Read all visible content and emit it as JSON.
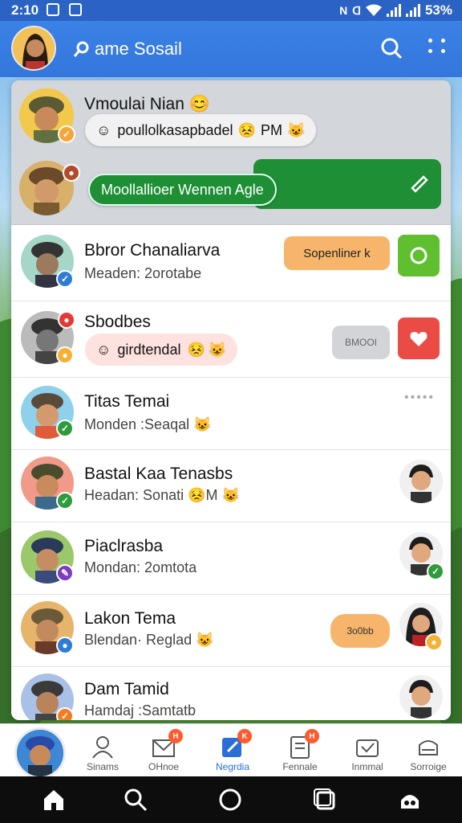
{
  "status_bar": {
    "time": "2:10",
    "battery": "53%"
  },
  "app_bar": {
    "title": "ame Sosail"
  },
  "pinned": [
    {
      "name": "Vmoulai Nian",
      "bubble": "poullolkasapbadel",
      "bubble_time": "PM"
    },
    {
      "bubble": "Moollallioer Wennen Agle"
    }
  ],
  "chats": [
    {
      "name": "Bbror Chanaliarva",
      "sub": "Meaden: 2orotabe",
      "action": "Sopenliner k"
    },
    {
      "name": "Sbodbes",
      "bubble": "girdtendal",
      "action": "BMOOI"
    },
    {
      "name": "Titas Temai",
      "sub": "Monden :Seaqal",
      "more": "•••••"
    },
    {
      "name": "Bastal Kaa Tenasbs",
      "sub": "Headan: Sonati",
      "sub_tail": "M"
    },
    {
      "name": "Piaclrasba",
      "sub": "Mondan: 2omtota"
    },
    {
      "name": "Lakon Tema",
      "sub": "Blendan· Reglad",
      "action": "3o0bb"
    },
    {
      "name": "Dam Tamid",
      "sub": "Hamdaj :Samtatb"
    }
  ],
  "bottom_nav": [
    {
      "label": "Sinams"
    },
    {
      "label": "OHnoe",
      "badge": "H"
    },
    {
      "label": "Negrdia",
      "badge": "K"
    },
    {
      "label": "Fennale",
      "badge": "H"
    },
    {
      "label": "Inmmal"
    },
    {
      "label": "Sorroige"
    }
  ],
  "colors": {
    "primary": "#3478dc",
    "green_bubble": "#1f8f36",
    "orange_button": "#f6b56a",
    "lime_square": "#5fbf2f",
    "red_square": "#ea4b45",
    "pinned_bg": "#d3d6db"
  },
  "icons": {
    "app_search": "search-icon",
    "app_menu": "more-icon",
    "sys_nav": [
      "home-icon",
      "search-icon",
      "circle-icon",
      "recents-icon",
      "assistant-icon"
    ]
  }
}
